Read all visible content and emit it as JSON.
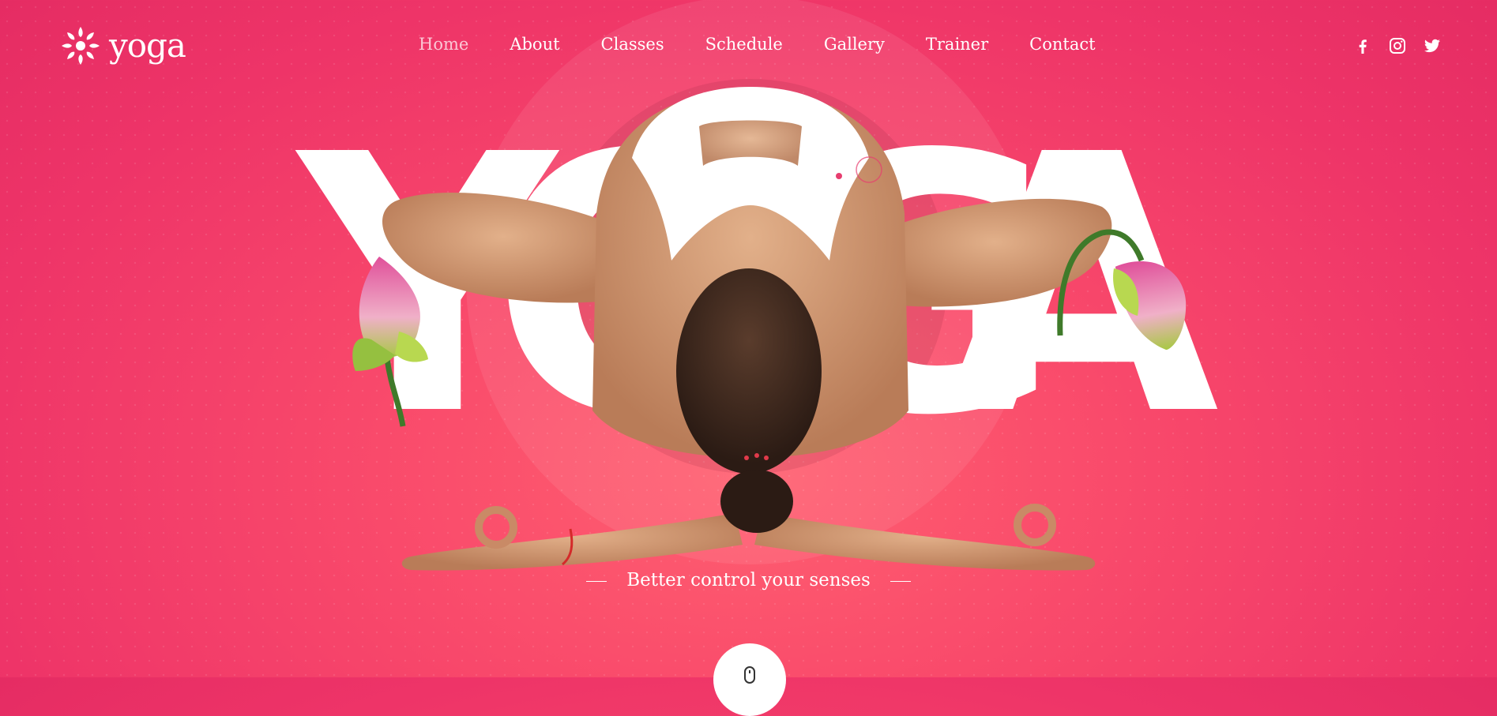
{
  "brand": {
    "name": "yoga",
    "logo_icon": "sun-flower-icon"
  },
  "nav": {
    "items": [
      {
        "label": "Home",
        "active": true
      },
      {
        "label": "About"
      },
      {
        "label": "Classes"
      },
      {
        "label": "Schedule"
      },
      {
        "label": "Gallery"
      },
      {
        "label": "Trainer"
      },
      {
        "label": "Contact"
      }
    ]
  },
  "social": [
    "facebook-icon",
    "instagram-icon",
    "twitter-icon"
  ],
  "hero": {
    "letters": [
      "Y",
      "O",
      "G",
      "A"
    ],
    "tagline": "Better control your senses"
  },
  "colors": {
    "background": "#ee3468",
    "accent": "#ffffff"
  }
}
